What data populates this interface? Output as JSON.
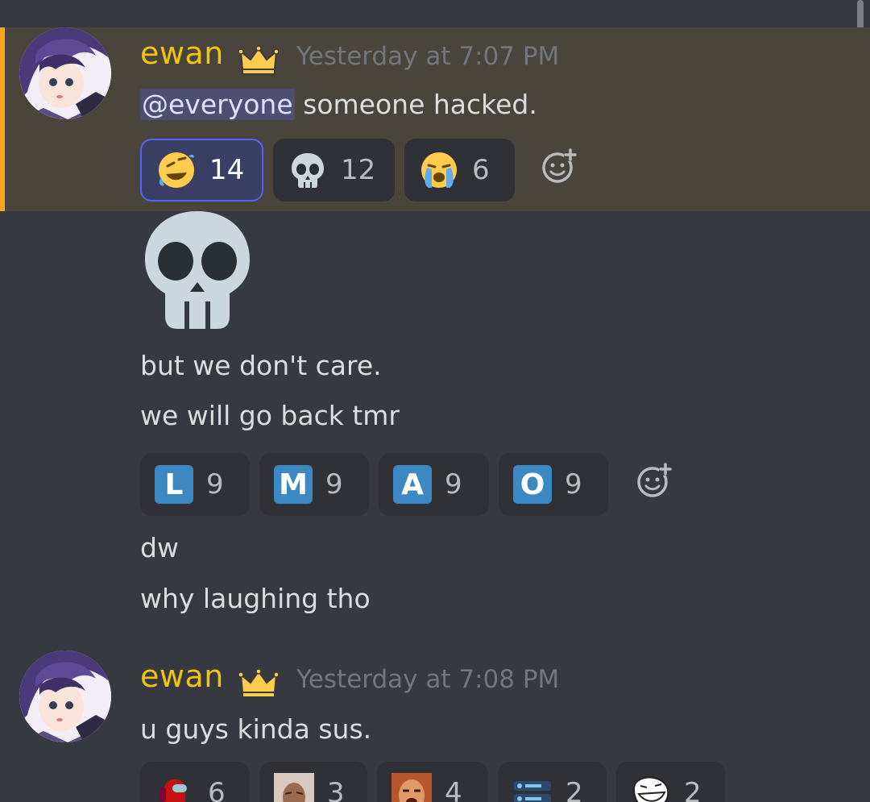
{
  "messages": [
    {
      "username": "ewan",
      "timestamp": "Yesterday at 7:07 PM",
      "mention": "@everyone",
      "text": " someone hacked.",
      "reactions": [
        {
          "emoji": "rolling-on-floor-laughing",
          "count": "14",
          "me": true
        },
        {
          "emoji": "skull",
          "count": "12",
          "me": false
        },
        {
          "emoji": "loudly-crying-face",
          "count": "6",
          "me": false
        }
      ]
    },
    {
      "emoji_only": "skull",
      "lines": [
        "but we don't care.",
        "we will go back tmr"
      ],
      "reactions": [
        {
          "letter": "L",
          "count": "9"
        },
        {
          "letter": "M",
          "count": "9"
        },
        {
          "letter": "A",
          "count": "9"
        },
        {
          "letter": "O",
          "count": "9"
        }
      ],
      "after_lines": [
        "dw",
        "why laughing tho"
      ]
    },
    {
      "username": "ewan",
      "timestamp": "Yesterday at 7:08 PM",
      "text": "u guys kinda sus.",
      "reactions": [
        {
          "emoji": "amogus",
          "count": "6"
        },
        {
          "emoji": "rock-face",
          "count": "3"
        },
        {
          "emoji": "laughing-man",
          "count": "4"
        },
        {
          "emoji": "server-icon",
          "count": "2"
        },
        {
          "emoji": "troll-face",
          "count": "2"
        }
      ]
    }
  ],
  "colors": {
    "background": "#36393f",
    "highlight": "#49443c",
    "highlight_bar": "#faa61a",
    "username": "#f1c40f",
    "mention_bg": "#5865f2"
  }
}
